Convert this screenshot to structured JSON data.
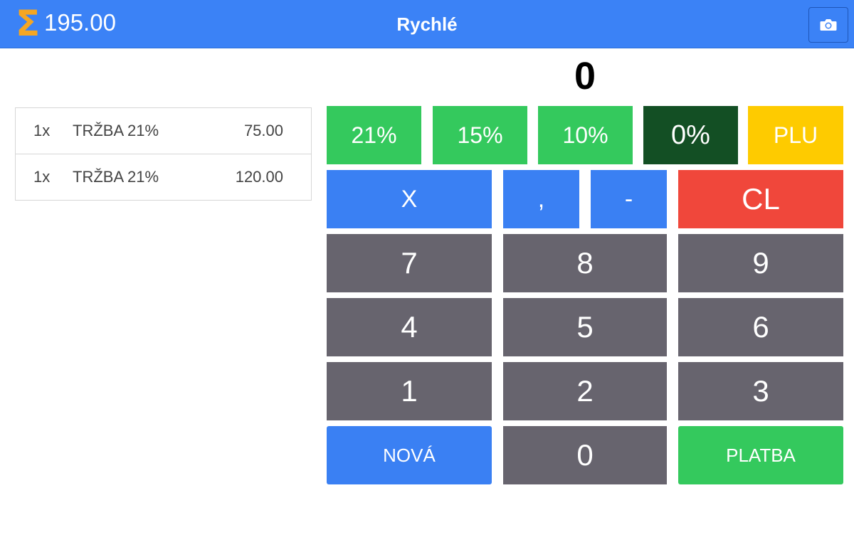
{
  "header": {
    "sigma_symbol": "Σ",
    "total": "195.00",
    "title": "Rychlé",
    "camera_icon": "camera-icon"
  },
  "display": {
    "value": "0"
  },
  "items": [
    {
      "qty": "1x",
      "name": "TRŽBA 21%",
      "price": "75.00"
    },
    {
      "qty": "1x",
      "name": "TRŽBA 21%",
      "price": "120.00"
    }
  ],
  "keypad": {
    "vat21": "21%",
    "vat15": "15%",
    "vat10": "10%",
    "vat0": "0%",
    "plu": "PLU",
    "multiply": "X",
    "comma": ",",
    "minus": "-",
    "clear": "CL",
    "seven": "7",
    "eight": "8",
    "nine": "9",
    "four": "4",
    "five": "5",
    "six": "6",
    "one": "1",
    "two": "2",
    "three": "3",
    "new": "NOVÁ",
    "zero": "0",
    "pay": "PLATBA"
  },
  "colors": {
    "header": "#3b82f6",
    "sigma": "#f5a623",
    "green": "#34c95d",
    "dark_green": "#134f24",
    "yellow": "#fecb00",
    "blue": "#3a80f3",
    "red": "#f0473b",
    "gray": "#67646e"
  }
}
